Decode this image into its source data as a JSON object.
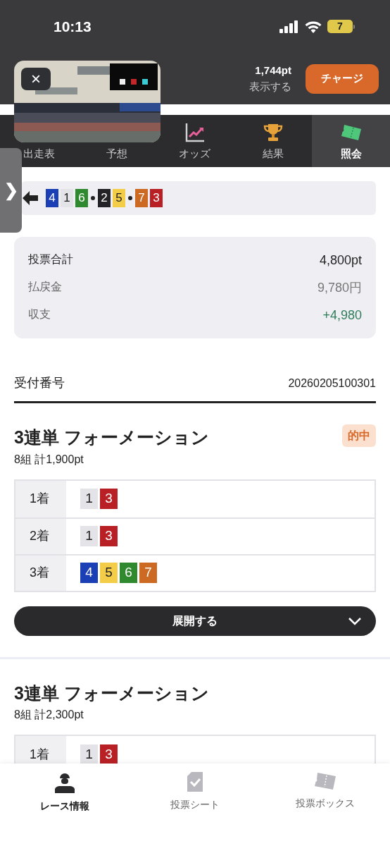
{
  "status_bar": {
    "time": "10:13",
    "battery": "7"
  },
  "header": {
    "points": "1,744pt",
    "show_label": "表示する",
    "charge_button": "チャージ"
  },
  "video": {
    "kind": "picture",
    "close": "×"
  },
  "tabs": [
    {
      "label": "出走表",
      "selected": false
    },
    {
      "label": "予想",
      "selected": false
    },
    {
      "label": "オッズ",
      "selected": false
    },
    {
      "label": "結果",
      "selected": false
    },
    {
      "label": "照会",
      "selected": true
    }
  ],
  "side_handle": "❯",
  "result_line": {
    "groups": [
      [
        {
          "text": "4",
          "color": "#1b3fb5"
        },
        {
          "text": "1",
          "color": "#e3e3e8"
        },
        {
          "text": "6",
          "color": "#2f8a2f"
        }
      ],
      [
        {
          "text": "2",
          "color": "#232325"
        },
        {
          "text": "5",
          "color": "#f3cd48"
        }
      ],
      [
        {
          "text": "7",
          "color": "#cc6a24"
        },
        {
          "text": "3",
          "color": "#b92025"
        }
      ]
    ]
  },
  "summary": [
    {
      "label": "投票合計",
      "value": "4,800pt",
      "kind": "total"
    },
    {
      "label": "払戻金",
      "value": "9,780円",
      "kind": "payout"
    },
    {
      "label": "収支",
      "value": "+4,980",
      "kind": "profit"
    }
  ],
  "receipt": {
    "label": "受付番号",
    "value": "20260205100301"
  },
  "bets": [
    {
      "title": "3連単 フォーメーション",
      "badge": "的中",
      "subtitle": "8組 計1,900pt",
      "expand": "展開する",
      "rows": [
        {
          "label": "1着",
          "numbers": [
            {
              "text": "1",
              "color": "#e3e3e8"
            },
            {
              "text": "3",
              "color": "#b92025"
            }
          ]
        },
        {
          "label": "2着",
          "numbers": [
            {
              "text": "1",
              "color": "#e3e3e8"
            },
            {
              "text": "3",
              "color": "#b92025"
            }
          ]
        },
        {
          "label": "3着",
          "numbers": [
            {
              "text": "4",
              "color": "#1b3fb5"
            },
            {
              "text": "5",
              "color": "#f3cd48"
            },
            {
              "text": "6",
              "color": "#2f8a2f"
            },
            {
              "text": "7",
              "color": "#cc6a24"
            }
          ]
        }
      ]
    },
    {
      "title": "3連単 フォーメーション",
      "subtitle": "8組 計2,300pt",
      "rows": [
        {
          "label": "1着",
          "numbers": [
            {
              "text": "1",
              "color": "#e3e3e8"
            },
            {
              "text": "3",
              "color": "#b92025"
            }
          ]
        }
      ]
    }
  ],
  "bottom_nav": [
    {
      "label": "レース情報",
      "selected": true
    },
    {
      "label": "投票シート",
      "selected": false
    },
    {
      "label": "投票ボックス",
      "selected": false
    }
  ]
}
